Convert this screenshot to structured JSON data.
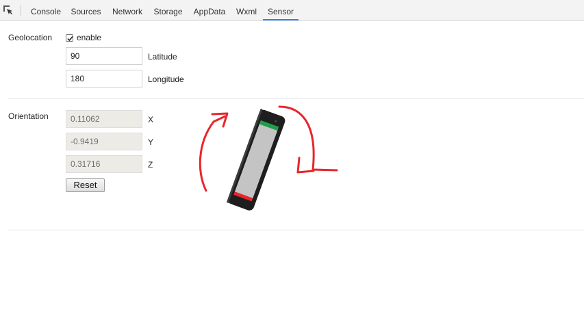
{
  "toolbar": {
    "inspect_icon": "element-select-icon",
    "tabs": [
      {
        "label": "Console",
        "active": false
      },
      {
        "label": "Sources",
        "active": false
      },
      {
        "label": "Network",
        "active": false
      },
      {
        "label": "Storage",
        "active": false
      },
      {
        "label": "AppData",
        "active": false
      },
      {
        "label": "Wxml",
        "active": false
      },
      {
        "label": "Sensor",
        "active": true
      }
    ],
    "active_color": "#3879d9"
  },
  "geolocation": {
    "label": "Geolocation",
    "enable_label": "enable",
    "enabled": true,
    "latitude_value": "90",
    "latitude_label": "Latitude",
    "longitude_value": "180",
    "longitude_label": "Longitude"
  },
  "orientation": {
    "label": "Orientation",
    "x_value": "0.11062",
    "x_label": "X",
    "y_value": "-0.9419",
    "y_label": "Y",
    "z_value": "0.31716",
    "z_label": "Z",
    "reset_label": "Reset",
    "visual": {
      "phone_icon": "rotated-phone-icon",
      "rotate_left_icon": "rotate-arrow-left-icon",
      "rotate_right_icon": "rotate-arrow-right-icon",
      "arrow_color": "#e8262b",
      "top_stripe_color": "#1e9e4a",
      "bottom_stripe_color": "#e8262b"
    }
  }
}
